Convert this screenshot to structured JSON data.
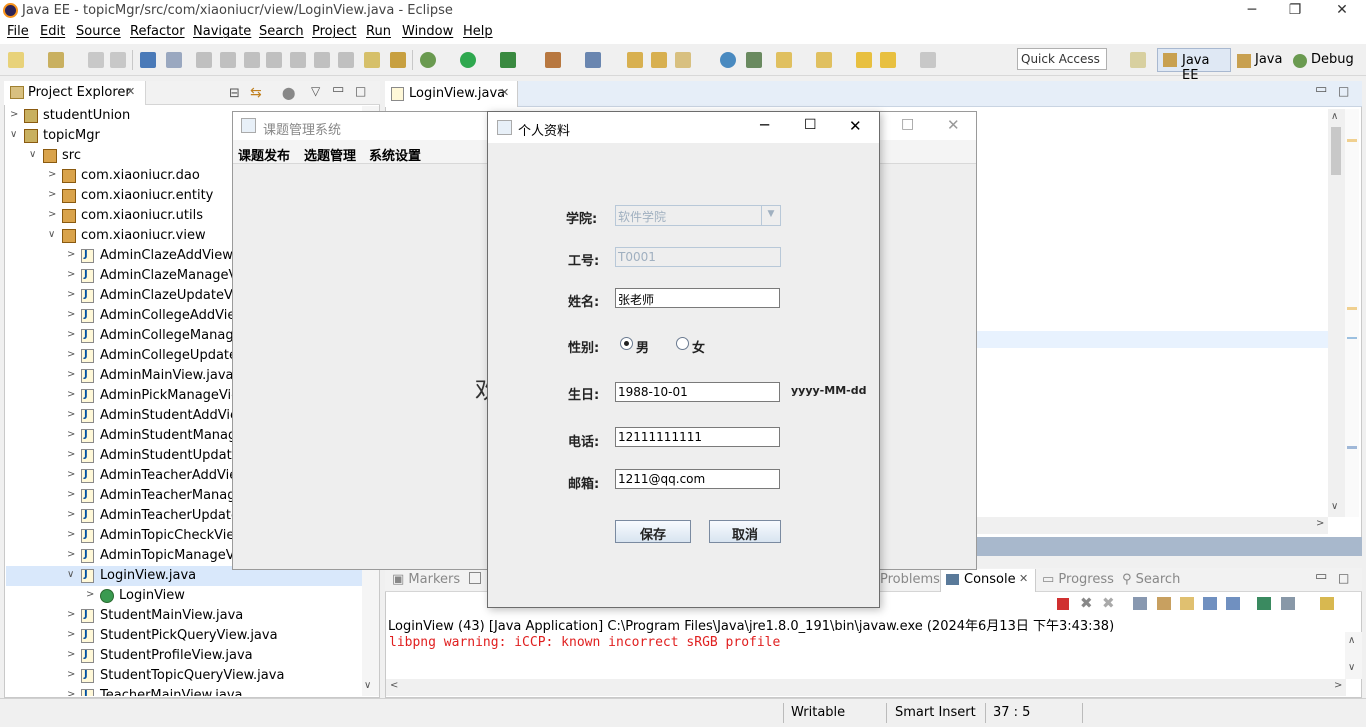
{
  "window": {
    "title": "Java EE - topicMgr/src/com/xiaoniucr/view/LoginView.java - Eclipse"
  },
  "menu": [
    "File",
    "Edit",
    "Source",
    "Refactor",
    "Navigate",
    "Search",
    "Project",
    "Run",
    "Window",
    "Help"
  ],
  "quick_access": {
    "placeholder": "Quick Access"
  },
  "perspectives": [
    "Java EE",
    "Java",
    "Debug"
  ],
  "project_explorer": {
    "title": "Project Explorer",
    "items": [
      {
        "label": "studentUnion",
        "indent": 0,
        "type": "project",
        "expanded": false
      },
      {
        "label": "topicMgr",
        "indent": 0,
        "type": "project",
        "expanded": true
      },
      {
        "label": "src",
        "indent": 1,
        "type": "folder",
        "expanded": true
      },
      {
        "label": "com.xiaoniucr.dao",
        "indent": 2,
        "type": "package",
        "expanded": false
      },
      {
        "label": "com.xiaoniucr.entity",
        "indent": 2,
        "type": "package",
        "expanded": false
      },
      {
        "label": "com.xiaoniucr.utils",
        "indent": 2,
        "type": "package",
        "expanded": false
      },
      {
        "label": "com.xiaoniucr.view",
        "indent": 2,
        "type": "package",
        "expanded": true
      },
      {
        "label": "AdminClazeAddView.java",
        "indent": 3,
        "type": "java",
        "expanded": false
      },
      {
        "label": "AdminClazeManageView.java",
        "indent": 3,
        "type": "java",
        "expanded": false
      },
      {
        "label": "AdminClazeUpdateView.java",
        "indent": 3,
        "type": "java",
        "expanded": false
      },
      {
        "label": "AdminCollegeAddView.java",
        "indent": 3,
        "type": "java",
        "expanded": false
      },
      {
        "label": "AdminCollegeManageView.java",
        "indent": 3,
        "type": "java",
        "expanded": false
      },
      {
        "label": "AdminCollegeUpdateView.java",
        "indent": 3,
        "type": "java",
        "expanded": false
      },
      {
        "label": "AdminMainView.java",
        "indent": 3,
        "type": "java",
        "expanded": false
      },
      {
        "label": "AdminPickManageView.java",
        "indent": 3,
        "type": "java",
        "expanded": false
      },
      {
        "label": "AdminStudentAddView.java",
        "indent": 3,
        "type": "java",
        "expanded": false
      },
      {
        "label": "AdminStudentManageView.java",
        "indent": 3,
        "type": "java",
        "expanded": false
      },
      {
        "label": "AdminStudentUpdateView.java",
        "indent": 3,
        "type": "java",
        "expanded": false
      },
      {
        "label": "AdminTeacherAddView.java",
        "indent": 3,
        "type": "java",
        "expanded": false
      },
      {
        "label": "AdminTeacherManageView.java",
        "indent": 3,
        "type": "java",
        "expanded": false
      },
      {
        "label": "AdminTeacherUpdateView.java",
        "indent": 3,
        "type": "java",
        "expanded": false
      },
      {
        "label": "AdminTopicCheckView.java",
        "indent": 3,
        "type": "java",
        "expanded": false
      },
      {
        "label": "AdminTopicManageView.java",
        "indent": 3,
        "type": "java",
        "expanded": false
      },
      {
        "label": "LoginView.java",
        "indent": 3,
        "type": "java",
        "expanded": true,
        "selected": true
      },
      {
        "label": "LoginView",
        "indent": 4,
        "type": "class",
        "expanded": false
      },
      {
        "label": "StudentMainView.java",
        "indent": 3,
        "type": "java",
        "expanded": false
      },
      {
        "label": "StudentPickQueryView.java",
        "indent": 3,
        "type": "java",
        "expanded": false
      },
      {
        "label": "StudentProfileView.java",
        "indent": 3,
        "type": "java",
        "expanded": false
      },
      {
        "label": "StudentTopicQueryView.java",
        "indent": 3,
        "type": "java",
        "expanded": false
      },
      {
        "label": "TeacherMainView.java",
        "indent": 3,
        "type": "java",
        "expanded": false
      }
    ]
  },
  "editor": {
    "tab": "LoginView.java"
  },
  "console": {
    "tabs": {
      "markers": "Markers",
      "problems": "Problems",
      "console": "Console",
      "progress": "Progress",
      "search": "Search"
    },
    "launch": "LoginView (43) [Java Application] C:\\Program Files\\Java\\jre1.8.0_191\\bin\\javaw.exe (2024年6月13日 下午3:43:38)",
    "line": "libpng warning: iCCP: known incorrect sRGB profile"
  },
  "status": {
    "writable": "Writable",
    "insert": "Smart Insert",
    "position": "37 : 5"
  },
  "swing_main": {
    "title": "课题管理系统",
    "menus": [
      "课题发布",
      "选题管理",
      "系统设置"
    ],
    "big_char": "欢"
  },
  "profile": {
    "title": "个人资料",
    "college_label": "学院:",
    "college_value": "软件学院",
    "id_label": "工号:",
    "id_value": "T0001",
    "name_label": "姓名:",
    "name_value": "张老师",
    "gender_label": "性别:",
    "male": "男",
    "female": "女",
    "birth_label": "生日:",
    "birth_value": "1988-10-01",
    "birth_hint": "yyyy-MM-dd",
    "phone_label": "电话:",
    "phone_value": "12111111111",
    "email_label": "邮箱:",
    "email_value": "1211@qq.com",
    "save": "保存",
    "cancel": "取消"
  }
}
